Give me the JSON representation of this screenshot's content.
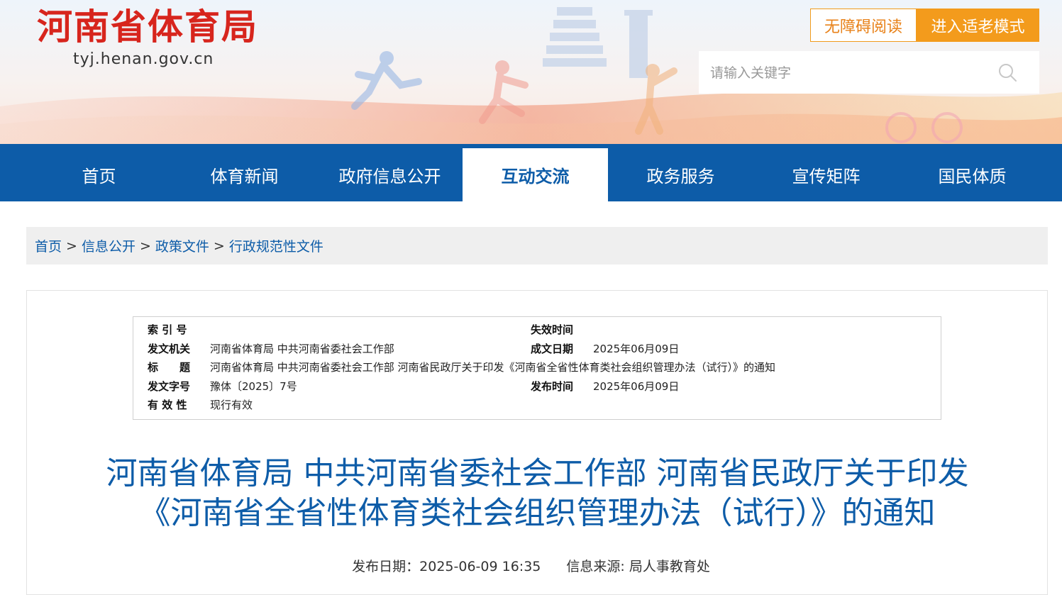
{
  "header": {
    "logo_title": "河南省体育局",
    "logo_domain": "tyj.henan.gov.cn",
    "accessible_label": "无障碍阅读",
    "elder_mode_label": "进入适老模式",
    "search_placeholder": "请输入关键字"
  },
  "nav": {
    "items": [
      {
        "label": "首页"
      },
      {
        "label": "体育新闻"
      },
      {
        "label": "政府信息公开"
      },
      {
        "label": "互动交流"
      },
      {
        "label": "政务服务"
      },
      {
        "label": "宣传矩阵"
      },
      {
        "label": "国民体质"
      }
    ],
    "active": "互动交流"
  },
  "breadcrumb": {
    "items": [
      "首页",
      "信息公开",
      "政策文件",
      "行政规范性文件"
    ],
    "separator": ">"
  },
  "meta": {
    "index_label": "索 引 号",
    "index_value": "",
    "expire_label": "失效时间",
    "expire_value": "",
    "issuer_label": "发文机关",
    "issuer_value": "河南省体育局 中共河南省委社会工作部",
    "written_label": "成文日期",
    "written_value": "2025年06月09日",
    "title_label": "标　　题",
    "title_value": "河南省体育局 中共河南省委社会工作部 河南省民政厅关于印发《河南省全省性体育类社会组织管理办法（试行）》的通知",
    "docno_label": "发文字号",
    "docno_value": "豫体〔2025〕7号",
    "publish_label": "发布时间",
    "publish_value": "2025年06月09日",
    "validity_label": "有 效 性",
    "validity_value": "现行有效"
  },
  "article": {
    "title_line1": "河南省体育局 中共河南省委社会工作部 河南省民政厅关于印发",
    "title_line2": "《河南省全省性体育类社会组织管理办法（试行）》的通知",
    "publish_date_label": "发布日期：",
    "publish_date_value": "2025-06-09 16:35",
    "source_label": "信息来源: ",
    "source_value": "局人事教育处"
  },
  "colors": {
    "brand_red": "#d7251d",
    "nav_blue": "#0d5ca8",
    "orange": "#f39b1c"
  },
  "icons": [
    "search-icon"
  ]
}
